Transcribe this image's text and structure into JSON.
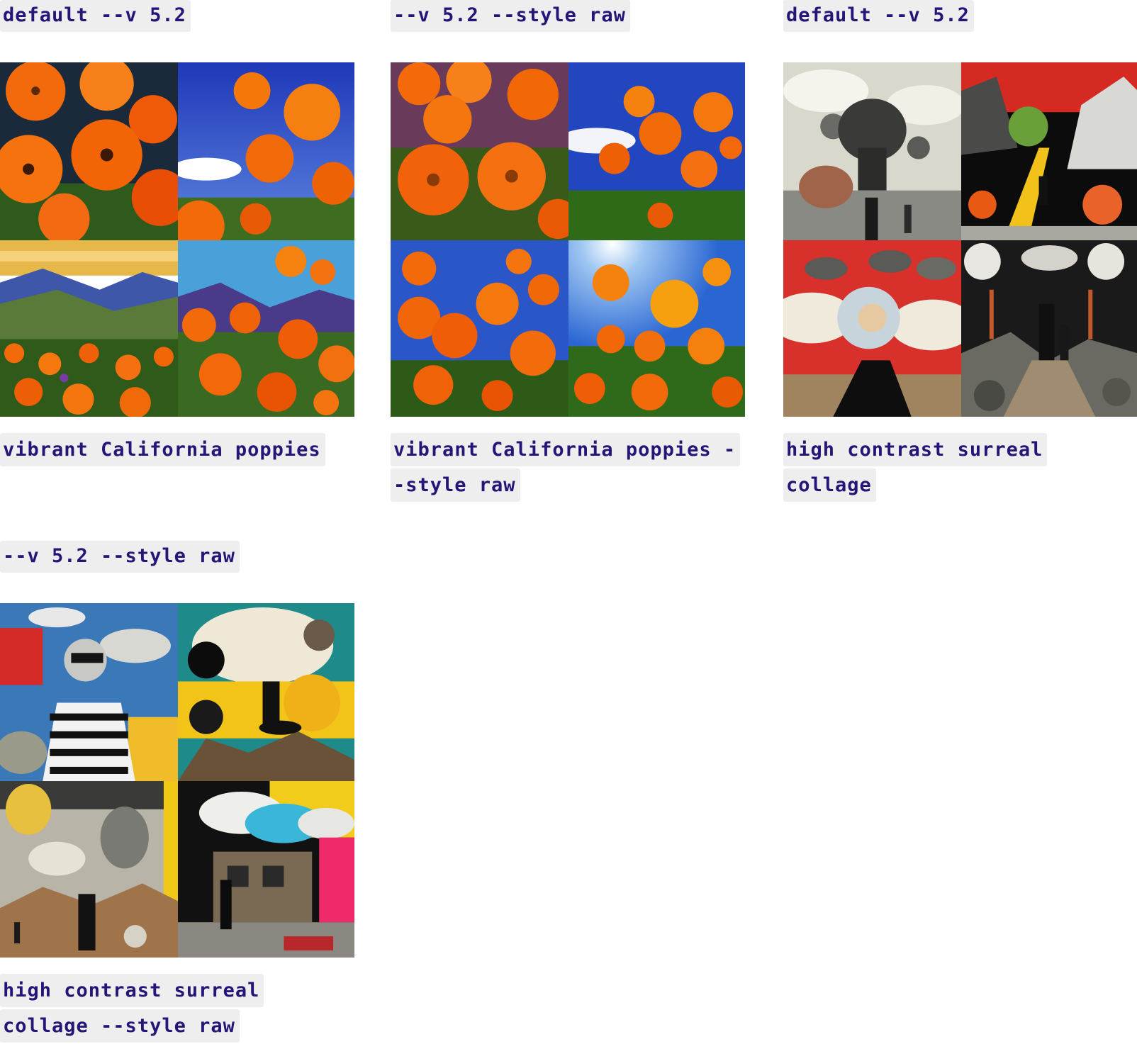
{
  "cards": [
    {
      "heading": "default --v 5.2",
      "caption": "vibrant California poppies",
      "images": [
        {
          "icon": "poppy-closeup-illustration-image"
        },
        {
          "icon": "poppy-blue-sky-image"
        },
        {
          "icon": "poppy-valley-landscape-image"
        },
        {
          "icon": "poppy-mountain-field-image"
        }
      ]
    },
    {
      "heading": "--v 5.2 --style raw",
      "caption": "vibrant California poppies --style raw",
      "images": [
        {
          "icon": "poppy-closeup-photo-image"
        },
        {
          "icon": "poppy-sky-photo-image"
        },
        {
          "icon": "poppy-field-photo-image"
        },
        {
          "icon": "poppy-sunlit-photo-image"
        }
      ]
    },
    {
      "heading": "default --v 5.2",
      "caption": "high contrast surreal collage",
      "images": [
        {
          "icon": "elephant-collage-image"
        },
        {
          "icon": "yellow-path-collage-image"
        },
        {
          "icon": "woman-red-collage-image"
        },
        {
          "icon": "walking-figures-collage-image"
        }
      ]
    },
    {
      "heading": "--v 5.2 --style raw",
      "caption": "high contrast surreal collage --style raw",
      "images": [
        {
          "icon": "striped-woman-collage-image"
        },
        {
          "icon": "seated-woman-collage-image"
        },
        {
          "icon": "balloon-collage-image"
        },
        {
          "icon": "house-cloud-collage-image"
        }
      ]
    }
  ],
  "colors": {
    "text": "#241577",
    "label_bg": "#eeeeef"
  }
}
